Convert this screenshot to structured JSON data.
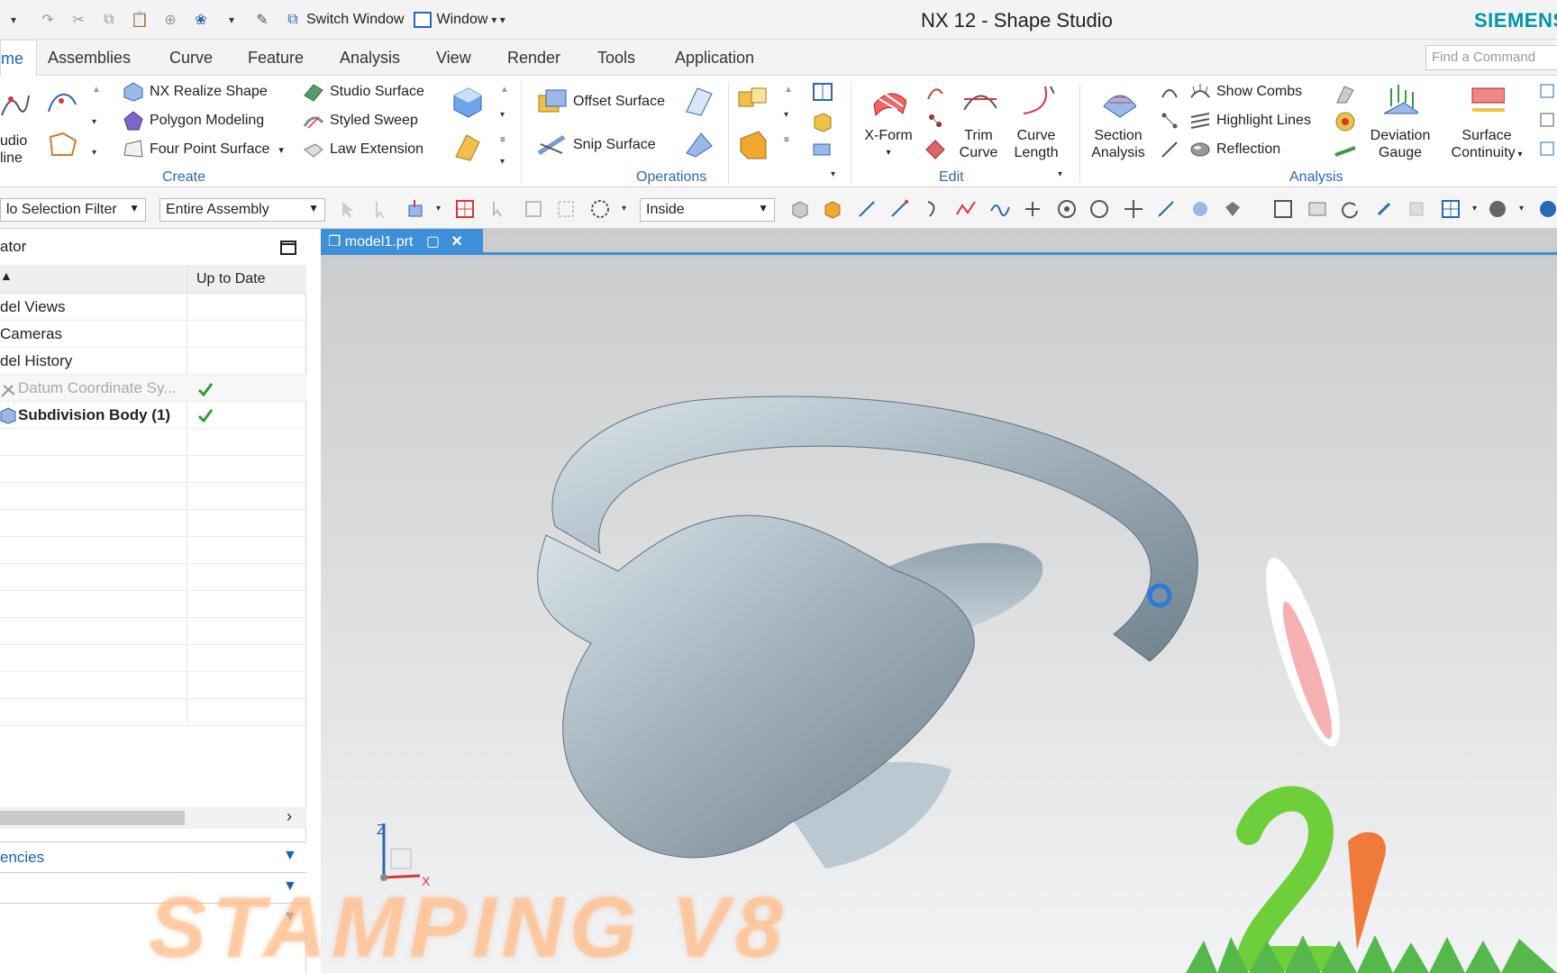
{
  "titlebar": {
    "title": "NX 12 - Shape Studio",
    "brand": "SIEMENS",
    "switch_window": "Switch Window",
    "window": "Window"
  },
  "menu": {
    "tabs": [
      "me",
      "Assemblies",
      "Curve",
      "Feature",
      "Analysis",
      "View",
      "Render",
      "Tools",
      "Application"
    ],
    "find_placeholder": "Find a Command"
  },
  "ribbon": {
    "studio_spline": [
      "udio",
      "line"
    ],
    "create": {
      "items": [
        "NX Realize Shape",
        "Polygon Modeling",
        "Four Point Surface",
        "Studio Surface",
        "Styled Sweep",
        "Law Extension"
      ],
      "label": "Create"
    },
    "operations": {
      "items": [
        "Offset Surface",
        "Snip Surface"
      ],
      "label": "Operations"
    },
    "edit": {
      "xform": "X-Form",
      "trim": [
        "Trim",
        "Curve"
      ],
      "curve_length": [
        "Curve",
        "Length"
      ],
      "label": "Edit"
    },
    "analysis": {
      "section": [
        "Section",
        "Analysis"
      ],
      "items": [
        "Show Combs",
        "Highlight Lines",
        "Reflection"
      ],
      "deviation": [
        "Deviation",
        "Gauge"
      ],
      "continuity": [
        "Surface",
        "Continuity"
      ],
      "label": "Analysis"
    }
  },
  "selection": {
    "filter": "lo Selection Filter",
    "scope": "Entire Assembly",
    "mode": "Inside"
  },
  "navigator": {
    "title": "ator",
    "col_status": "Up to Date",
    "rows": [
      "del Views",
      "Cameras",
      "del History",
      "Datum Coordinate Sy...",
      "Subdivision Body (1)"
    ],
    "sections": [
      "encies"
    ]
  },
  "document": {
    "tab": "model1.prt"
  },
  "axes": {
    "z": "Z",
    "x": "X"
  },
  "overlay": {
    "watermark": "STAMPING V8"
  },
  "colors": {
    "accent": "#3d8fd8",
    "group_label": "#2a67b5",
    "brand": "#0096a8",
    "check": "#2e9e2e"
  }
}
